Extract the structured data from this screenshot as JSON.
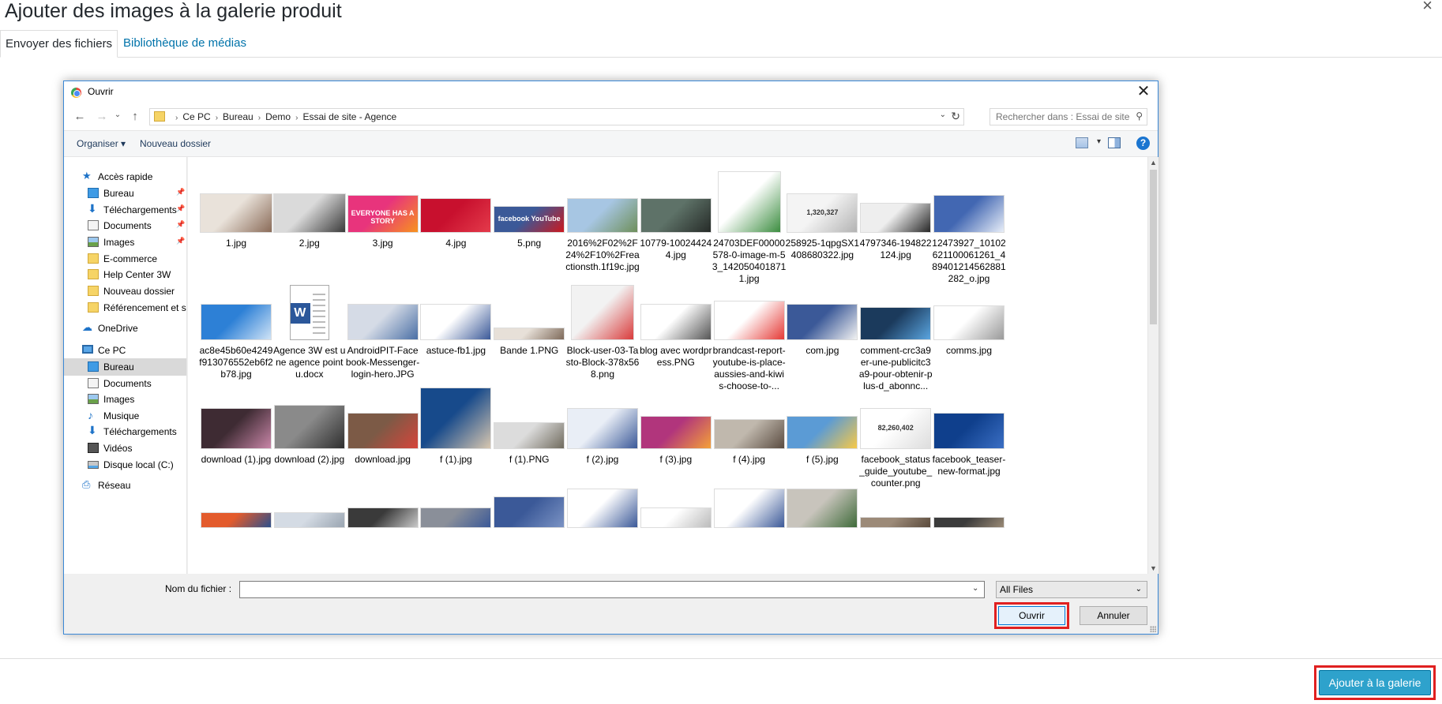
{
  "wp": {
    "title": "Ajouter des images à la galerie produit",
    "close_glyph": "×",
    "tab_upload": "Envoyer des fichiers",
    "tab_library": "Bibliothèque de médias",
    "add_button": "Ajouter à la galerie"
  },
  "dialog": {
    "title": "Ouvrir",
    "close_glyph": "✕",
    "nav": {
      "back": "←",
      "forward": "→",
      "recent": "⌄",
      "up": "↑",
      "dropdown": "⌄",
      "refresh": "↻"
    },
    "breadcrumb": [
      "Ce PC",
      "Bureau",
      "Demo",
      "Essai de site - Agence"
    ],
    "search_placeholder": "Rechercher dans : Essai de site...",
    "toolbar": {
      "organize": "Organiser ▾",
      "new_folder": "Nouveau dossier",
      "help": "?"
    },
    "sidebar": [
      {
        "label": "Accès rapide",
        "icon": "star",
        "indent": 0,
        "pinned": false
      },
      {
        "label": "Bureau",
        "icon": "desk",
        "indent": 1,
        "pinned": true
      },
      {
        "label": "Téléchargements",
        "icon": "dl",
        "indent": 1,
        "pinned": true
      },
      {
        "label": "Documents",
        "icon": "doc",
        "indent": 1,
        "pinned": true
      },
      {
        "label": "Images",
        "icon": "img",
        "indent": 1,
        "pinned": true
      },
      {
        "label": "E-commerce",
        "icon": "folder",
        "indent": 1,
        "pinned": false
      },
      {
        "label": "Help Center 3W",
        "icon": "folder",
        "indent": 1,
        "pinned": false
      },
      {
        "label": "Nouveau dossier",
        "icon": "folder",
        "indent": 1,
        "pinned": false
      },
      {
        "label": "Référencement et s",
        "icon": "folder",
        "indent": 1,
        "pinned": false
      },
      {
        "label": "OneDrive",
        "icon": "cloud",
        "indent": 0,
        "pinned": false
      },
      {
        "label": "Ce PC",
        "icon": "pc",
        "indent": 0,
        "pinned": false
      },
      {
        "label": "Bureau",
        "icon": "desk",
        "indent": 1,
        "pinned": false,
        "selected": true
      },
      {
        "label": "Documents",
        "icon": "doc",
        "indent": 1,
        "pinned": false
      },
      {
        "label": "Images",
        "icon": "img",
        "indent": 1,
        "pinned": false
      },
      {
        "label": "Musique",
        "icon": "music",
        "indent": 1,
        "pinned": false
      },
      {
        "label": "Téléchargements",
        "icon": "dl",
        "indent": 1,
        "pinned": false
      },
      {
        "label": "Vidéos",
        "icon": "video",
        "indent": 1,
        "pinned": false
      },
      {
        "label": "Disque local (C:)",
        "icon": "drive",
        "indent": 1,
        "pinned": false
      },
      {
        "label": "Réseau",
        "icon": "net",
        "indent": 0,
        "pinned": false
      }
    ],
    "pin_glyph": "📌",
    "files": [
      {
        "name": "1.jpg",
        "colors": [
          "#e9e2da",
          "#8a6b58"
        ]
      },
      {
        "name": "2.jpg",
        "colors": [
          "#dadada",
          "#3a3a3a"
        ]
      },
      {
        "name": "3.jpg",
        "colors": [
          "#e8347c",
          "#f7931e"
        ],
        "text": "EVERYONE HAS A STORY"
      },
      {
        "name": "4.jpg",
        "colors": [
          "#c8102e",
          "#e43b4b"
        ]
      },
      {
        "name": "5.png",
        "colors": [
          "#3b5998",
          "#cc181e"
        ],
        "text": "facebook YouTube"
      },
      {
        "name": "2016%2F02%2F24%2F10%2Freactionsth.1f19c.jpg",
        "colors": [
          "#a7c6e3",
          "#6e8f5a"
        ]
      },
      {
        "name": "10779-100244244.jpg",
        "colors": [
          "#5e7268",
          "#262b28"
        ]
      },
      {
        "name": "24703DEF00000578-0-image-m-53_1420504018711.jpg",
        "colors": [
          "#ffffff",
          "#3c8d40"
        ]
      },
      {
        "name": "258925-1qpgSX1408680322.jpg",
        "colors": [
          "#f4f4f4",
          "#b3b3b3"
        ],
        "text": "1,320,327"
      },
      {
        "name": "4797346-194822124.jpg",
        "colors": [
          "#eeeeee",
          "#272727"
        ]
      },
      {
        "name": "12473927_10102621100061261_489401214562881282_o.jpg",
        "colors": [
          "#4267b2",
          "#e8eef8"
        ]
      },
      {
        "name": "ac8e45b60e4249f913076552eb6f2b78.jpg",
        "colors": [
          "#2d80d6",
          "#cfe3f6"
        ]
      },
      {
        "name": "Agence 3W est une agence pointu.docx",
        "colors": [
          "#ffffff",
          "#2b579a"
        ],
        "doc": true
      },
      {
        "name": "AndroidPIT-Facebook-Messenger-login-hero.JPG",
        "colors": [
          "#d5dbe6",
          "#4a6fa5"
        ]
      },
      {
        "name": "astuce-fb1.jpg",
        "colors": [
          "#ffffff",
          "#3b5998"
        ]
      },
      {
        "name": "Bande 1.PNG",
        "colors": [
          "#e7e0d8",
          "#7e6a5a"
        ]
      },
      {
        "name": "Block-user-03-Tasto-Block-378x568.png",
        "colors": [
          "#f2f2f2",
          "#d93b3b"
        ]
      },
      {
        "name": "blog avec wordpress.PNG",
        "colors": [
          "#ffffff",
          "#555555"
        ]
      },
      {
        "name": "brandcast-report-youtube-is-place-aussies-and-kiwis-choose-to-...",
        "colors": [
          "#ffffff",
          "#e53935"
        ]
      },
      {
        "name": "com.jpg",
        "colors": [
          "#3b5998",
          "#f2f2f2"
        ]
      },
      {
        "name": "comment-crc3a9er-une-publicitc3a9-pour-obtenir-plus-d_abonnc...",
        "colors": [
          "#1b3a5c",
          "#5aa5e0"
        ]
      },
      {
        "name": "comms.jpg",
        "colors": [
          "#ffffff",
          "#999999"
        ]
      },
      {
        "name": "download (1).jpg",
        "colors": [
          "#3e2b33",
          "#c986a8"
        ]
      },
      {
        "name": "download (2).jpg",
        "colors": [
          "#8a8a8a",
          "#2e2e2e"
        ]
      },
      {
        "name": "download.jpg",
        "colors": [
          "#7c5a46",
          "#d6453b"
        ]
      },
      {
        "name": "f (1).jpg",
        "colors": [
          "#174a8b",
          "#d8c7b0"
        ]
      },
      {
        "name": "f (1).PNG",
        "colors": [
          "#dcdcdc",
          "#706b5e"
        ]
      },
      {
        "name": "f (2).jpg",
        "colors": [
          "#e9eef6",
          "#3b5998"
        ]
      },
      {
        "name": "f (3).jpg",
        "colors": [
          "#b1357c",
          "#f4a138"
        ]
      },
      {
        "name": "f (4).jpg",
        "colors": [
          "#c0b8ad",
          "#5a4b40"
        ]
      },
      {
        "name": "f (5).jpg",
        "colors": [
          "#5b9bd5",
          "#f7c948"
        ]
      },
      {
        "name": "facebook_status_guide_youtube_counter.png",
        "colors": [
          "#ffffff",
          "#dddddd"
        ],
        "text": "82,260,402"
      },
      {
        "name": "facebook_teaser-new-format.jpg",
        "colors": [
          "#0f3f8c",
          "#3b6fc4"
        ]
      },
      {
        "name": "",
        "colors": [
          "#e35b2c",
          "#2b4f8c"
        ]
      },
      {
        "name": "",
        "colors": [
          "#d4dbe4",
          "#9aa5b1"
        ]
      },
      {
        "name": "",
        "colors": [
          "#3a3a3a",
          "#c9c9c9"
        ]
      },
      {
        "name": "",
        "colors": [
          "#8a8f99",
          "#3b5998"
        ]
      },
      {
        "name": "",
        "colors": [
          "#3b5998",
          "#7b93c4"
        ]
      },
      {
        "name": "",
        "colors": [
          "#ffffff",
          "#3b5998"
        ]
      },
      {
        "name": "",
        "colors": [
          "#ffffff",
          "#bbbbbb"
        ]
      },
      {
        "name": "",
        "colors": [
          "#ffffff",
          "#3b5998"
        ]
      },
      {
        "name": "",
        "colors": [
          "#c8c4bc",
          "#3f6b3a"
        ]
      },
      {
        "name": "",
        "colors": [
          "#9c8a78",
          "#5a4a3c"
        ]
      },
      {
        "name": "",
        "colors": [
          "#3b3b3b",
          "#9a8a76"
        ]
      }
    ],
    "filename_label": "Nom du fichier :",
    "filename_value": "",
    "filetype": "All Files",
    "open_button": "Ouvrir",
    "cancel_button": "Annuler"
  },
  "colors": {
    "accent": "#0078d7",
    "wp_button": "#2ea2cc",
    "highlight": "#e02020"
  }
}
